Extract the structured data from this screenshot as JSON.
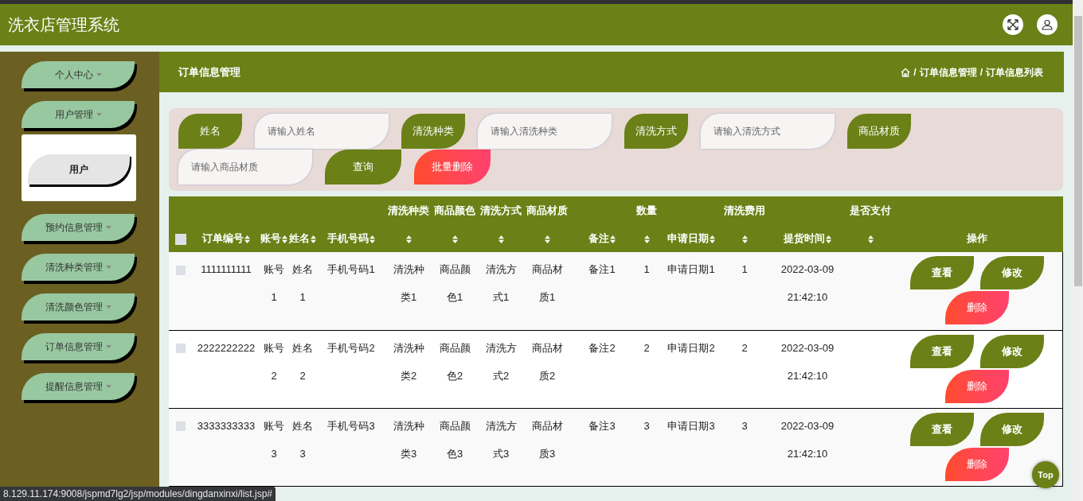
{
  "app_title": "洗衣店管理系统",
  "sidebar": {
    "items": [
      {
        "label": "个人中心"
      },
      {
        "label": "用户管理",
        "children": [
          {
            "label": "用户"
          }
        ]
      },
      {
        "label": "预约信息管理"
      },
      {
        "label": "清洗种类管理"
      },
      {
        "label": "清洗颜色管理"
      },
      {
        "label": "订单信息管理"
      },
      {
        "label": "提醒信息管理"
      }
    ]
  },
  "page_title": "订单信息管理",
  "breadcrumb": {
    "separator": "/",
    "items": [
      "订单信息管理",
      "订单信息列表"
    ]
  },
  "search": {
    "fields": [
      {
        "label": "姓名",
        "placeholder": "请输入姓名"
      },
      {
        "label": "清洗种类",
        "placeholder": "请输入清洗种类"
      },
      {
        "label": "清洗方式",
        "placeholder": "请输入清洗方式"
      },
      {
        "label": "商品材质",
        "placeholder": "请输入商品材质"
      }
    ],
    "buttons": [
      {
        "label": "查询",
        "kind": "search"
      },
      {
        "label": "批量删除",
        "kind": "delete"
      }
    ]
  },
  "table": {
    "select_all_checked": false,
    "columns": [
      {
        "label": "订单编号",
        "kind": "data"
      },
      {
        "label": "账号",
        "kind": "data"
      },
      {
        "label": "姓名",
        "kind": "data"
      },
      {
        "label": "手机号码",
        "kind": "data"
      },
      {
        "label": "清洗种类",
        "kind": "data"
      },
      {
        "label": "商品颜色",
        "kind": "data"
      },
      {
        "label": "清洗方式",
        "kind": "data"
      },
      {
        "label": "商品材质",
        "kind": "data"
      },
      {
        "label": "备注",
        "kind": "data"
      },
      {
        "label": "数量",
        "kind": "data"
      },
      {
        "label": "申请日期",
        "kind": "data"
      },
      {
        "label": "清洗费用",
        "kind": "data"
      },
      {
        "label": "提货时间",
        "kind": "data"
      },
      {
        "label": "是否支付",
        "kind": "data"
      },
      {
        "label": "操作",
        "kind": "actions"
      }
    ],
    "rows": [
      {
        "checked": false,
        "cells": [
          "1111111111",
          "账号1",
          "姓名1",
          "手机号码1",
          "清洗种类1",
          "商品颜色1",
          "清洗方式1",
          "商品材质1",
          "备注1",
          "1",
          "申请日期1",
          "1",
          "2022-03-09 21:42:10"
        ],
        "actions": [
          {
            "label": "查看",
            "kind": "view"
          },
          {
            "label": "修改",
            "kind": "edit"
          },
          {
            "label": "删除",
            "kind": "delete"
          }
        ]
      },
      {
        "checked": false,
        "cells": [
          "2222222222",
          "账号2",
          "姓名2",
          "手机号码2",
          "清洗种类2",
          "商品颜色2",
          "清洗方式2",
          "商品材质2",
          "备注2",
          "2",
          "申请日期2",
          "2",
          "2022-03-09 21:42:10"
        ],
        "actions": [
          {
            "label": "查看",
            "kind": "view"
          },
          {
            "label": "修改",
            "kind": "edit"
          },
          {
            "label": "删除",
            "kind": "delete"
          }
        ]
      },
      {
        "checked": false,
        "cells": [
          "3333333333",
          "账号3",
          "姓名3",
          "手机号码3",
          "清洗种类3",
          "商品颜色3",
          "清洗方式3",
          "商品材质3",
          "备注3",
          "3",
          "申请日期3",
          "3",
          "2022-03-09 21:42:10"
        ],
        "actions": [
          {
            "label": "查看",
            "kind": "view"
          },
          {
            "label": "修改",
            "kind": "edit"
          },
          {
            "label": "删除",
            "kind": "delete"
          }
        ]
      }
    ]
  },
  "back_to_top": "Top",
  "status_url": "8.129.11.174:9008/jspmd7lg2/jsp/modules/dingdanxinxi/list.jsp#"
}
